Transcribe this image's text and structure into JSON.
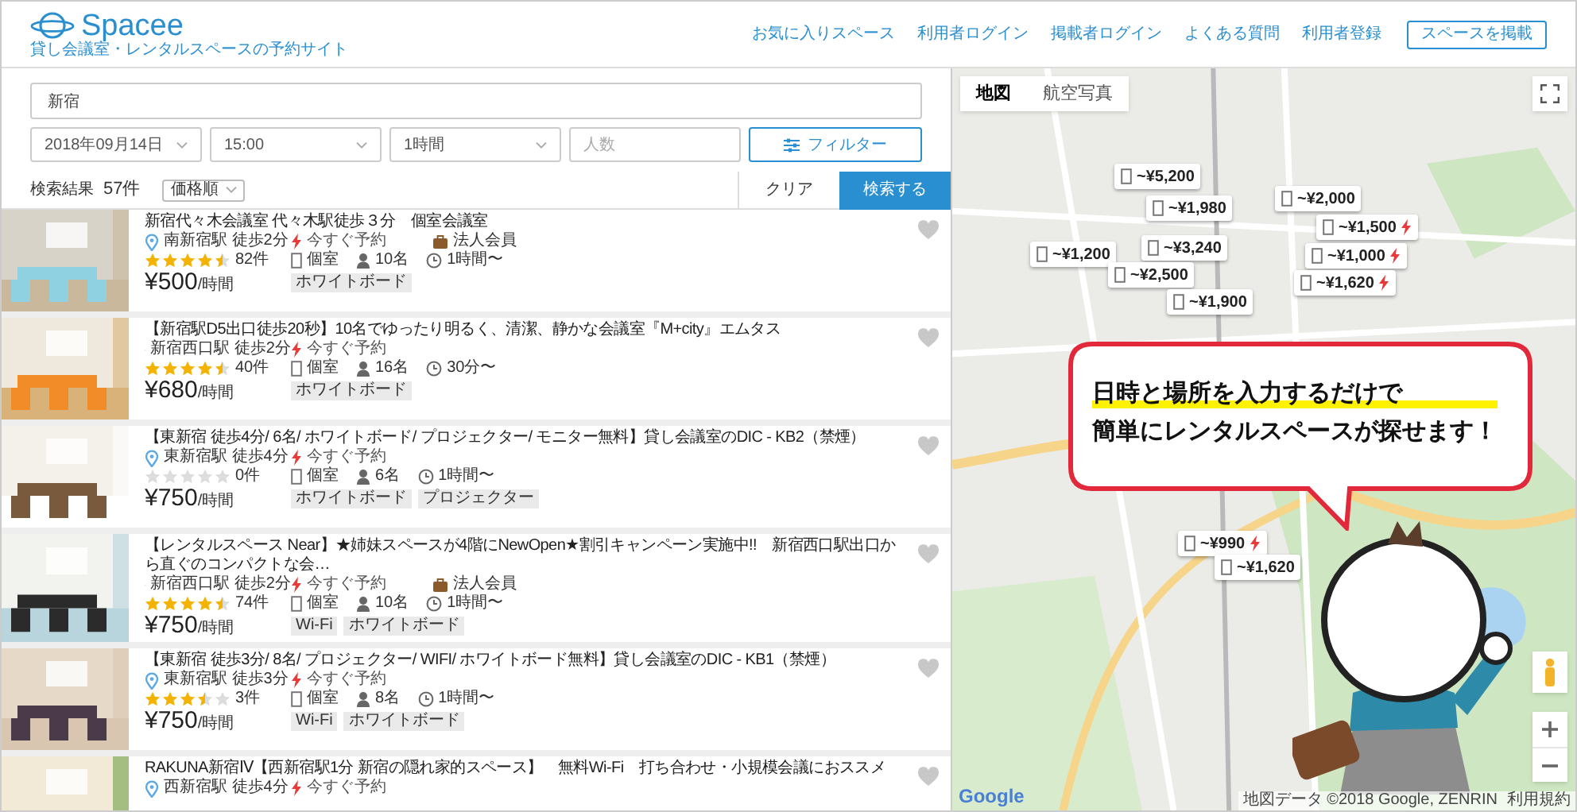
{
  "header": {
    "logo": "Spacee",
    "tagline": "貸し会議室・レンタルスペースの予約サイト",
    "links": [
      "お気に入りスペース",
      "利用者ログイン",
      "掲載者ログイン",
      "よくある質問",
      "利用者登録"
    ],
    "cta": "スペースを掲載"
  },
  "search": {
    "location": "新宿",
    "date": "2018年09月14日",
    "time": "15:00",
    "duration": "1時間",
    "people_placeholder": "人数",
    "filter": "フィルター"
  },
  "results": {
    "label": "検索結果",
    "count": "57件",
    "sort": "価格順",
    "clear": "クリア",
    "submit": "検索する"
  },
  "listings": [
    {
      "title": "新宿代々木会議室 代々木駅徒歩３分　個室会議室",
      "station": "南新宿駅 徒歩2分",
      "instant": "今すぐ予約",
      "corporate": "法人会員",
      "stars": 4.5,
      "reviews": "82件",
      "room": "個室",
      "capacity": "10名",
      "min_time": "1時間〜",
      "price": "¥500",
      "unit": "/時間",
      "tags": [
        "ホワイトボード"
      ]
    },
    {
      "title": "【新宿駅D5出口徒歩20秒】10名でゆったり明るく、清潔、静かな会議室『M+city』エムタス",
      "station": "新宿西口駅 徒歩2分",
      "instant": "今すぐ予約",
      "stars": 4.5,
      "reviews": "40件",
      "room": "個室",
      "capacity": "16名",
      "min_time": "30分〜",
      "price": "¥680",
      "unit": "/時間",
      "tags": [
        "ホワイトボード"
      ]
    },
    {
      "title": "【東新宿 徒歩4分/ 6名/ ホワイトボード/ プロジェクター/ モニター無料】貸し会議室のDIC - KB2（禁煙）",
      "station": "東新宿駅 徒歩4分",
      "instant": "今すぐ予約",
      "stars": 0,
      "reviews": "0件",
      "room": "個室",
      "capacity": "6名",
      "min_time": "1時間〜",
      "price": "¥750",
      "unit": "/時間",
      "tags": [
        "ホワイトボード",
        "プロジェクター"
      ]
    },
    {
      "title": "【レンタルスペース Near】★姉妹スペースが4階にNewOpen★割引キャンペーン実施中!!　新宿西口駅出口から直ぐのコンパクトな会…",
      "station": "新宿西口駅 徒歩2分",
      "instant": "今すぐ予約",
      "corporate": "法人会員",
      "stars": 4.5,
      "reviews": "74件",
      "room": "個室",
      "capacity": "10名",
      "min_time": "1時間〜",
      "price": "¥750",
      "unit": "/時間",
      "tags": [
        "Wi-Fi",
        "ホワイトボード"
      ]
    },
    {
      "title": "【東新宿 徒歩3分/ 8名/ プロジェクター/ WIFI/ ホワイトボード無料】貸し会議室のDIC - KB1（禁煙）",
      "station": "東新宿駅 徒歩3分",
      "instant": "今すぐ予約",
      "stars": 3.5,
      "reviews": "3件",
      "room": "個室",
      "capacity": "8名",
      "min_time": "1時間〜",
      "price": "¥750",
      "unit": "/時間",
      "tags": [
        "Wi-Fi",
        "ホワイトボード"
      ]
    },
    {
      "title": "RAKUNA新宿Ⅳ【西新宿駅1分 新宿の隠れ家的スペース】　無料Wi-Fi　打ち合わせ・小規模会議におススメ",
      "station": "西新宿駅 徒歩4分",
      "instant": "今すぐ予約"
    }
  ],
  "map": {
    "tabs": [
      {
        "label": "地図",
        "selected": true
      },
      {
        "label": "航空写真",
        "selected": false
      }
    ],
    "markers": [
      {
        "price": "~¥5,200",
        "instant": false
      },
      {
        "price": "~¥1,980",
        "instant": false
      },
      {
        "price": "~¥2,000",
        "instant": false
      },
      {
        "price": "~¥1,500",
        "instant": true
      },
      {
        "price": "~¥1,200",
        "instant": false
      },
      {
        "price": "~¥3,240",
        "instant": false
      },
      {
        "price": "~¥2,500",
        "instant": false
      },
      {
        "price": "~¥1,000",
        "instant": true
      },
      {
        "price": "~¥1,620",
        "instant": true
      },
      {
        "price": "~¥1,900",
        "instant": false
      },
      {
        "price": "~¥990",
        "instant": true
      },
      {
        "price": "~¥1,620",
        "instant": false
      }
    ],
    "callout": {
      "highlight": "日時と場所を入力するだけで",
      "line2": "簡単にレンタルスペースが探せます！"
    },
    "google": "Google",
    "attribution": "地図データ ©2018 Google, ZENRIN",
    "terms": "利用規約"
  }
}
